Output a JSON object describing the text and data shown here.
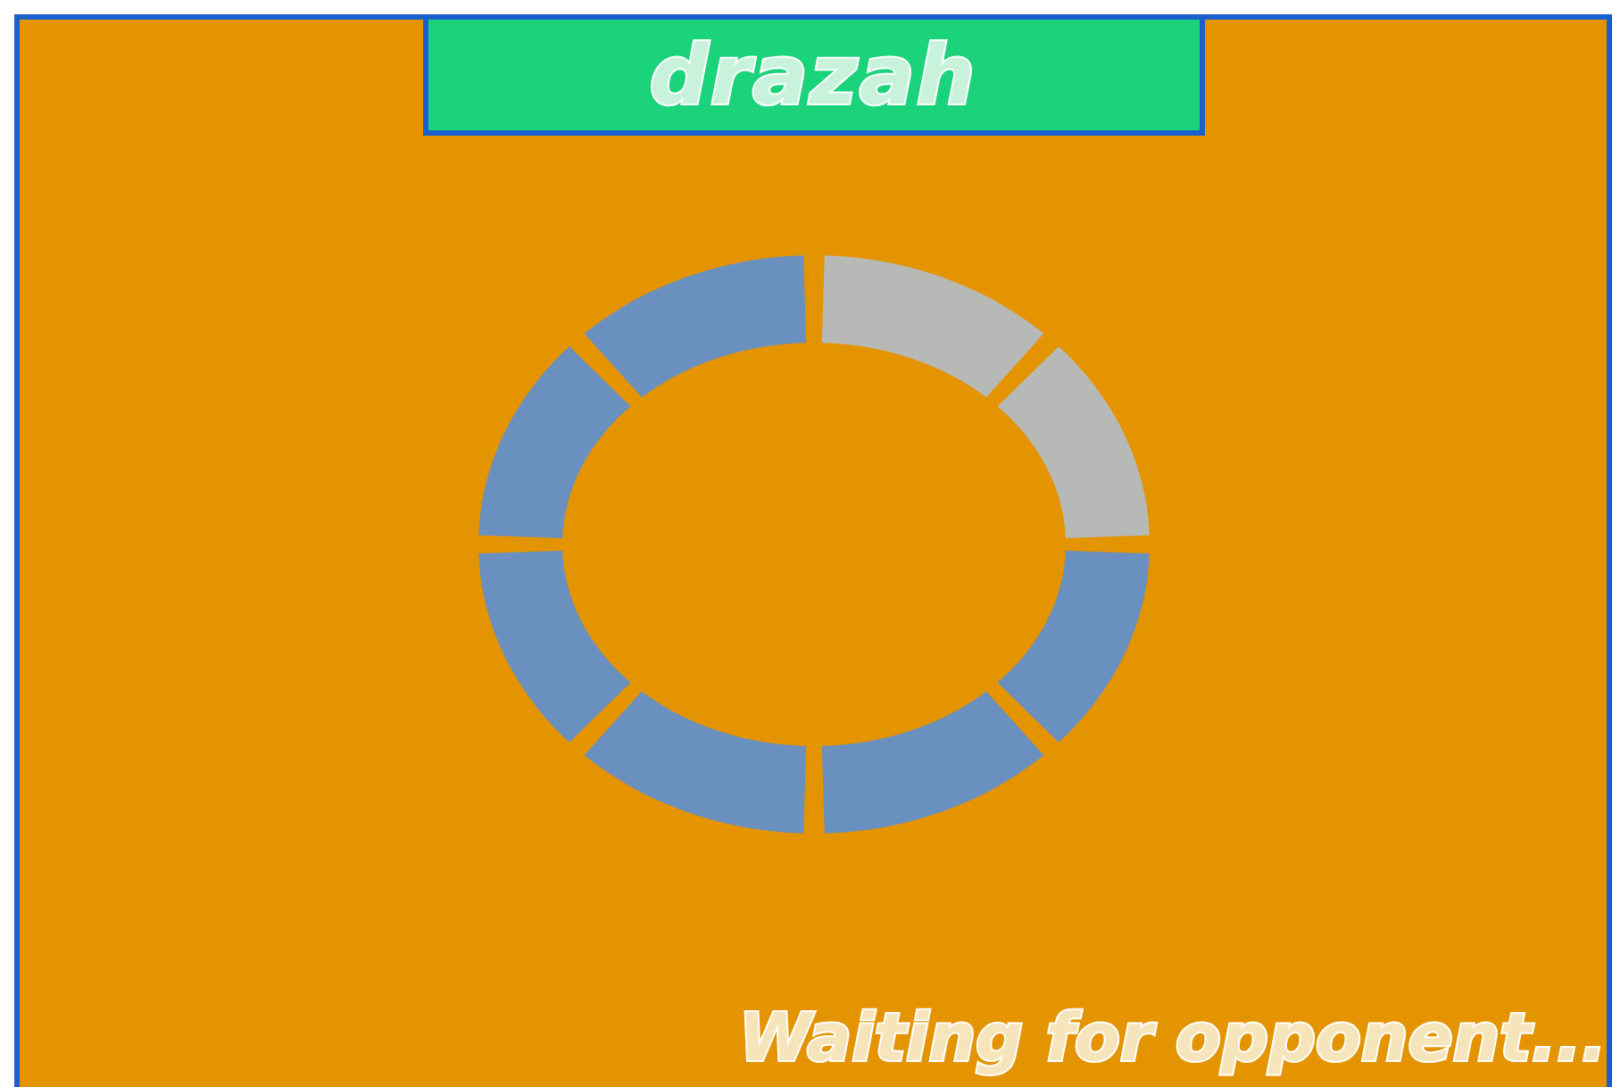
{
  "title": "drazah",
  "spinner": {
    "segments": [
      {
        "lit": true
      },
      {
        "lit": true
      },
      {
        "lit": false
      },
      {
        "lit": false
      },
      {
        "lit": false
      },
      {
        "lit": false
      },
      {
        "lit": false
      },
      {
        "lit": false
      }
    ]
  },
  "status": "Waiting for opponent..."
}
